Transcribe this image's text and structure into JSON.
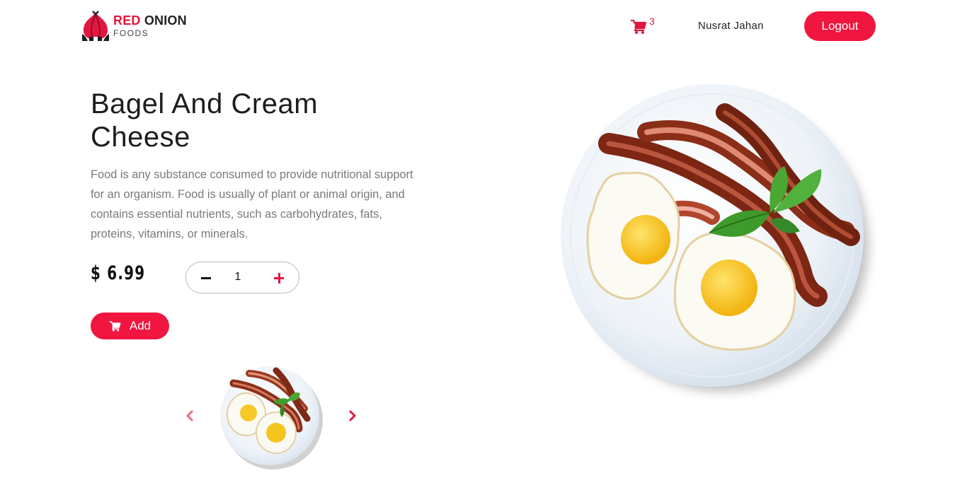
{
  "header": {
    "logo": {
      "brand_red": "RED",
      "brand_dark": "ONION",
      "sub": "FOODS",
      "icon": "onion-icon"
    },
    "cart": {
      "icon": "cart-icon",
      "count": "3"
    },
    "user_name": "Nusrat Jahan",
    "logout_label": "Logout"
  },
  "product": {
    "title": "Bagel And Cream Cheese",
    "description": "Food is any substance consumed to provide nutritional support for an organism. Food is usually of plant or animal origin, and contains essential nutrients, such as carbohydrates, fats, proteins, vitamins, or minerals.",
    "price": "$ 6.99",
    "quantity": "1",
    "add_label": "Add"
  },
  "carousel": {
    "prev_icon": "chevron-left-icon",
    "next_icon": "chevron-right-icon"
  },
  "colors": {
    "accent": "#f0163f",
    "text": "#1d1d1d",
    "muted": "#7a7a7a"
  }
}
